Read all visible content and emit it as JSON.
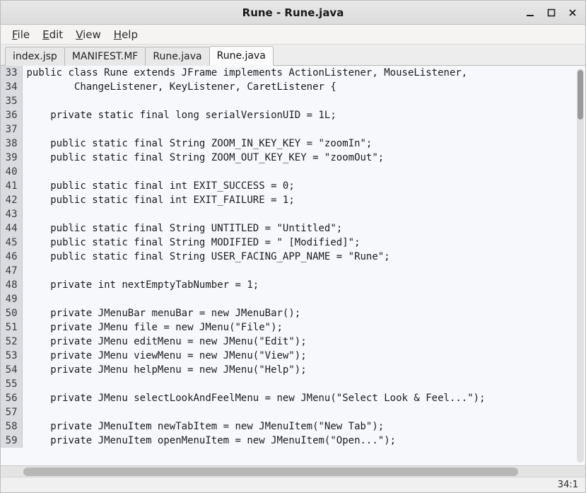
{
  "titlebar": {
    "title": "Rune - Rune.java"
  },
  "menubar": {
    "items": [
      {
        "label": "File",
        "accel": "F"
      },
      {
        "label": "Edit",
        "accel": "E"
      },
      {
        "label": "View",
        "accel": "V"
      },
      {
        "label": "Help",
        "accel": "H"
      }
    ]
  },
  "tabs": [
    {
      "label": "index.jsp",
      "active": false
    },
    {
      "label": "MANIFEST.MF",
      "active": false
    },
    {
      "label": "Rune.java",
      "active": false
    },
    {
      "label": "Rune.java",
      "active": true
    }
  ],
  "gutter_start": 33,
  "code_lines": [
    "public class Rune extends JFrame implements ActionListener, MouseListener,",
    "        ChangeListener, KeyListener, CaretListener {",
    "",
    "    private static final long serialVersionUID = 1L;",
    "",
    "    public static final String ZOOM_IN_KEY_KEY = \"zoomIn\";",
    "    public static final String ZOOM_OUT_KEY_KEY = \"zoomOut\";",
    "",
    "    public static final int EXIT_SUCCESS = 0;",
    "    public static final int EXIT_FAILURE = 1;",
    "",
    "    public static final String UNTITLED = \"Untitled\";",
    "    public static final String MODIFIED = \" [Modified]\";",
    "    public static final String USER_FACING_APP_NAME = \"Rune\";",
    "",
    "    private int nextEmptyTabNumber = 1;",
    "",
    "    private JMenuBar menuBar = new JMenuBar();",
    "    private JMenu file = new JMenu(\"File\");",
    "    private JMenu editMenu = new JMenu(\"Edit\");",
    "    private JMenu viewMenu = new JMenu(\"View\");",
    "    private JMenu helpMenu = new JMenu(\"Help\");",
    "",
    "    private JMenu selectLookAndFeelMenu = new JMenu(\"Select Look & Feel...\");",
    "",
    "    private JMenuItem newTabItem = new JMenuItem(\"New Tab\");",
    "    private JMenuItem openMenuItem = new JMenuItem(\"Open...\");"
  ],
  "status": {
    "cursor": "34:1"
  }
}
